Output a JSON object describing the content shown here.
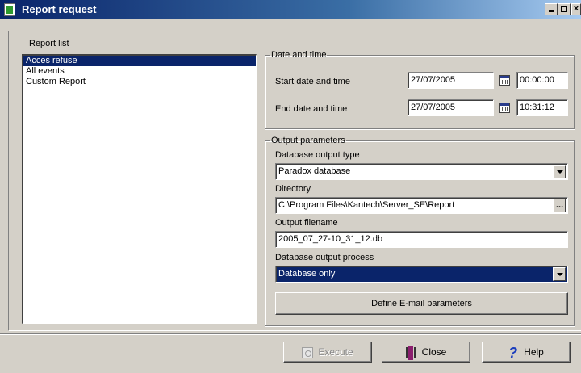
{
  "window": {
    "title": "Report request"
  },
  "report_list": {
    "label": "Report list",
    "items": [
      "Acces refuse",
      "All events",
      "Custom Report"
    ],
    "selected": "Acces refuse"
  },
  "date_time": {
    "legend": "Date and time",
    "start_label": "Start date and time",
    "start_date": "27/07/2005",
    "start_time": "00:00:00",
    "end_label": "End date and time",
    "end_date": "27/07/2005",
    "end_time": "10:31:12"
  },
  "output": {
    "legend": "Output parameters",
    "db_type_label": "Database output type",
    "db_type_value": "Paradox database",
    "directory_label": "Directory",
    "directory_value": "C:\\Program Files\\Kantech\\Server_SE\\Report",
    "filename_label": "Output filename",
    "filename_value": "2005_07_27-10_31_12.db",
    "process_label": "Database output process",
    "process_value": "Database only",
    "email_button": "Define E-mail parameters"
  },
  "buttons": {
    "execute": "Execute",
    "close": "Close",
    "help": "Help"
  },
  "colors": {
    "title_bar": "#0a246a",
    "selection": "#0a246a",
    "face": "#d4d0c8"
  }
}
